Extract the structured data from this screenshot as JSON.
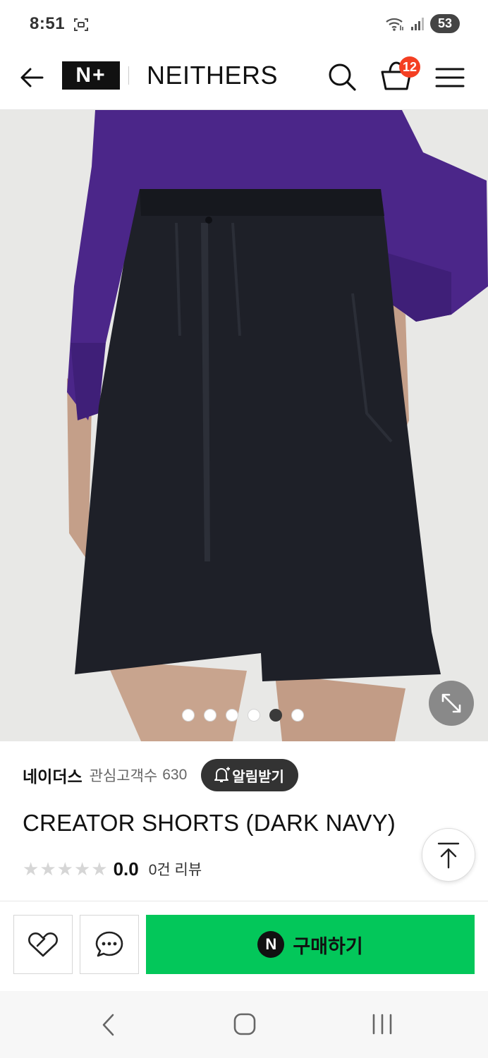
{
  "status_bar": {
    "time": "8:51",
    "battery": "53",
    "icons": [
      "screenshot-icon",
      "wifi-icon",
      "signal-icon"
    ]
  },
  "header": {
    "logo": "N+",
    "brand": "NEITHERS",
    "cart_count": "12",
    "icons": [
      "back-arrow-icon",
      "search-icon",
      "cart-icon",
      "menu-icon"
    ]
  },
  "gallery": {
    "total_slides": 6,
    "active_slide": 5
  },
  "store": {
    "name": "네이더스",
    "follower_label": "관심고객수",
    "follower_count": "630",
    "notify_label": "알림받기"
  },
  "product": {
    "title": "CREATOR SHORTS (DARK NAVY)",
    "rating": "0.0",
    "stars": 0,
    "review_count": "0건 리뷰"
  },
  "actions": {
    "buy_label": "구매하기",
    "buy_badge": "N",
    "icons": [
      "heart-icon",
      "chat-bubble-icon",
      "arrow-up-icon",
      "expand-icon"
    ]
  },
  "colors": {
    "buy_green": "#03c75a",
    "cart_badge": "#f43f22",
    "sweater": "#4b2689",
    "shorts": "#1e2028"
  }
}
